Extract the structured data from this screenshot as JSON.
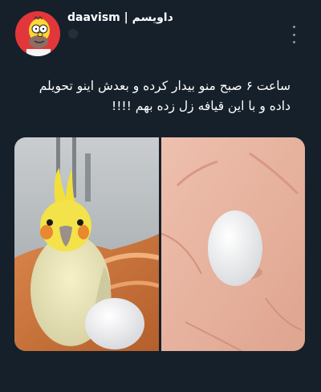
{
  "author": {
    "display_name": "daavism | داویسم",
    "avatar_icon": "homer-simpson-avatar",
    "avatar_bg": "#e2373a"
  },
  "tweet": {
    "text": "ساعت ۶ صبح منو بیدار کرده و بعدش اینو تحویلم داده و با این قیافه زل زده بهم !!!!"
  },
  "media": {
    "left_image": "cockatiel-with-egg",
    "right_image": "egg-in-palm"
  },
  "colors": {
    "background": "#15202b",
    "text": "#ffffff",
    "muted": "#8899a6"
  }
}
